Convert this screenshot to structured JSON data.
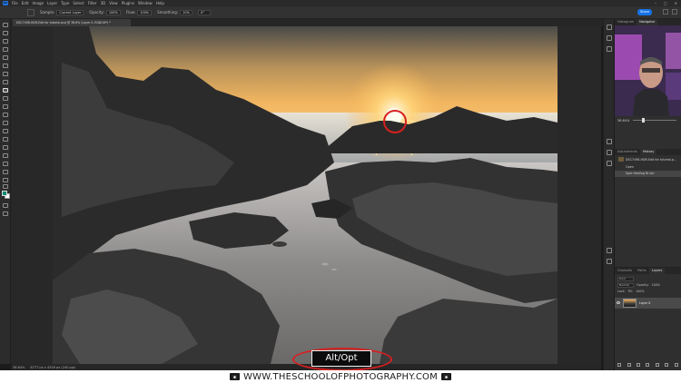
{
  "app": {
    "logo": "Ps",
    "menus": [
      "File",
      "Edit",
      "Image",
      "Layer",
      "Type",
      "Select",
      "Filter",
      "3D",
      "View",
      "Plugins",
      "Window",
      "Help"
    ]
  },
  "options_bar": {
    "sample_label": "Sample:",
    "sample_value": "Current Layer",
    "opacity_label": "Opacity:",
    "opacity_value": "100%",
    "flow_label": "Flow:",
    "flow_value": "100%",
    "smoothing_label": "Smoothing:",
    "smoothing_value": "10%",
    "angle_value": "0°",
    "share_label": "Share"
  },
  "document": {
    "tab_title": "DSC7498-HDR-Edit for tutorial.psd @ 36.6% (Layer 0, RGB/16*) *",
    "zoom": "36.64%",
    "doc_info": "6777 px x 4516 px (240 ppi)"
  },
  "panels": {
    "top_tabs": [
      "Histogram",
      "Navigator"
    ],
    "zoom_value": "36.64%",
    "history_tabs": [
      "Adjustments",
      "History"
    ],
    "history_snapshot": "DSC7498-HDR-Edit for tutorial.p...",
    "history_items": [
      "Open",
      "Spot Healing Brush"
    ],
    "layer_tabs": [
      "Channels",
      "Paths",
      "Layers"
    ],
    "kind_label": "Kind",
    "blend_mode": "Normal",
    "opacity_label": "Opacity:",
    "opacity_value": "100%",
    "lock_label": "Lock:",
    "fill_label": "Fill:",
    "fill_value": "100%",
    "layer_name": "Layer 0"
  },
  "overlay": {
    "key_badge": "Alt/Opt"
  },
  "watermark": {
    "text": "WWW.THESCHOOLOFPHOTOGRAPHY.COM"
  },
  "colors": {
    "accent_red": "#d62020",
    "ps_blue": "#1473e6",
    "foreground_swatch": "#0e8a72",
    "background_swatch": "#ffffff"
  }
}
